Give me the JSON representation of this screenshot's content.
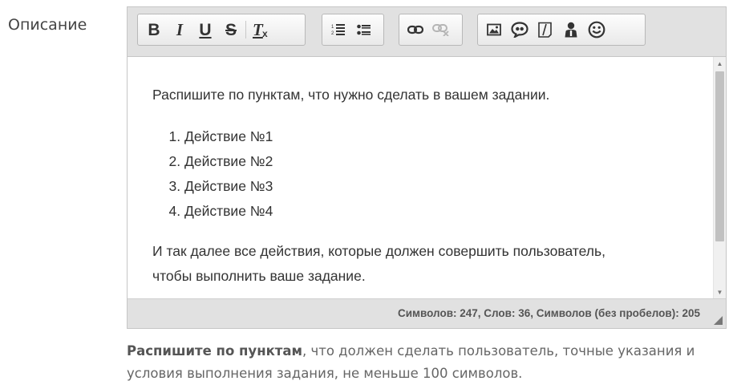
{
  "form": {
    "label": "Описание"
  },
  "toolbar": {
    "groups": [
      {
        "buttons": [
          {
            "icon": "bold-icon",
            "glyph": "B"
          },
          {
            "icon": "italic-icon",
            "glyph": "I"
          },
          {
            "icon": "underline-icon",
            "glyph": "U"
          },
          {
            "icon": "strikethrough-icon",
            "glyph": "S"
          },
          {
            "icon": "remove-format-icon",
            "glyph": "Tx"
          }
        ]
      },
      {
        "buttons": [
          {
            "icon": "numbered-list-icon"
          },
          {
            "icon": "bulleted-list-icon"
          }
        ]
      },
      {
        "buttons": [
          {
            "icon": "link-icon"
          },
          {
            "icon": "unlink-icon",
            "disabled": true
          }
        ]
      },
      {
        "buttons": [
          {
            "icon": "image-icon"
          },
          {
            "icon": "blockquote-icon"
          },
          {
            "icon": "spoiler-icon"
          },
          {
            "icon": "user-icon"
          },
          {
            "icon": "smiley-icon"
          }
        ]
      }
    ]
  },
  "editor": {
    "intro": "Распишите по пунктам, что нужно сделать в вашем задании.",
    "list": [
      "Действие №1",
      "Действие №2",
      "Действие №3",
      "Действие №4"
    ],
    "outro_line1": "И так далее все действия, которые должен совершить пользователь,",
    "outro_line2": "чтобы выполнить ваше задание."
  },
  "status": {
    "counter": "Символов: 247, Слов: 36, Символов (без пробелов): 205"
  },
  "hint": {
    "bold": "Распишите по пунктам",
    "rest_line1": ", что должен сделать пользователь, точные указания и",
    "line2": "условия выполнения задания, не меньше 100 символов."
  },
  "colors": {
    "toolbar_bg": "#e1e1e1",
    "border": "#c6c6c6",
    "text": "#333333",
    "hint_text": "#666666"
  }
}
